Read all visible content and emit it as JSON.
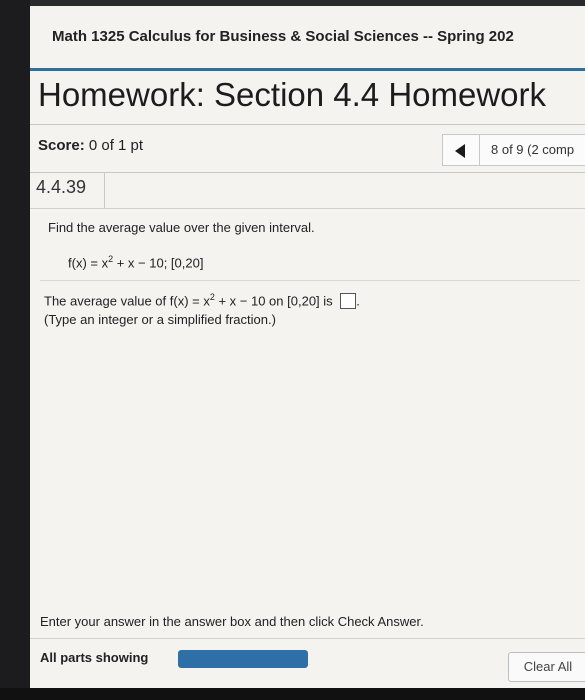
{
  "course": {
    "title": "Math 1325 Calculus for Business & Social Sciences -- Spring 202"
  },
  "homework": {
    "title": "Homework: Section 4.4 Homework"
  },
  "score": {
    "label": "Score:",
    "value": "0 of 1 pt"
  },
  "pager": {
    "text": "8 of 9 (2 comp",
    "prev_icon": "left-triangle-icon"
  },
  "question": {
    "number": "4.4.39",
    "prompt": "Find the average value over the given interval.",
    "function_prefix": "f(x) = x",
    "function_exponent": "2",
    "function_suffix": " + x − 10; [0,20]",
    "answer_prefix": "The average value of f(x) = x",
    "answer_exponent": "2",
    "answer_suffix": " + x − 10 on [0,20] is",
    "answer_value": "",
    "answer_trailing": ".",
    "hint": "(Type an integer or a simplified fraction.)"
  },
  "footer": {
    "instruction": "Enter your answer in the answer box and then click Check Answer.",
    "parts_label": "All parts showing",
    "progress_fraction": 1.0,
    "clear_label": "Clear All"
  },
  "colors": {
    "accent": "#2e6f9e",
    "progress": "#2e6fa8"
  }
}
